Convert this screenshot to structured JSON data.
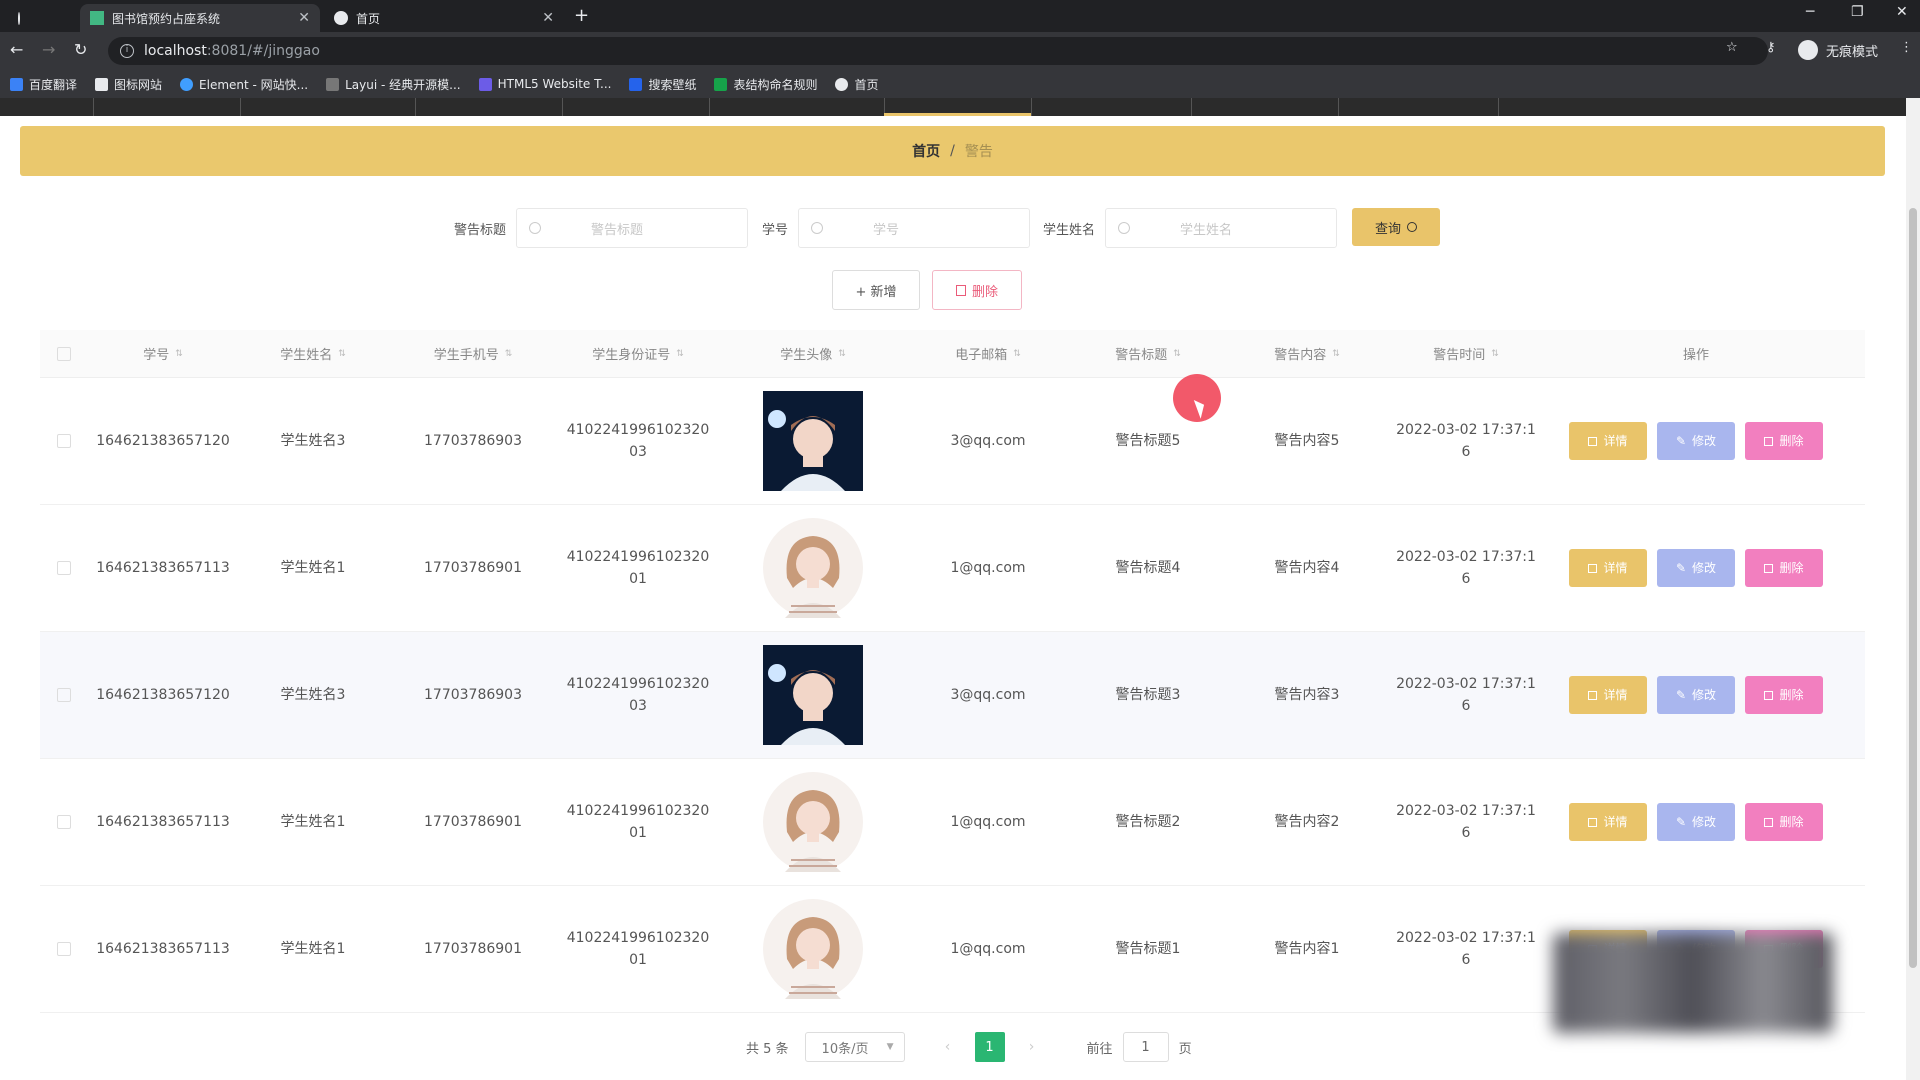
{
  "browser": {
    "tabs": [
      {
        "title": "图书馆预约占座系统"
      },
      {
        "title": "首页"
      }
    ],
    "url_host": "localhost",
    "url_path": ":8081/#/jinggao",
    "incognito_label": "无痕模式",
    "bookmarks": [
      "百度翻译",
      "图标网站",
      "Element - 网站快...",
      "Layui - 经典开源模...",
      "HTML5 Website T...",
      "搜索壁纸",
      "表结构命名规则",
      "首页"
    ]
  },
  "breadcrumb": {
    "home": "首页",
    "separator": "/",
    "current": "警告"
  },
  "search": {
    "title_label": "警告标题",
    "title_placeholder": "警告标题",
    "id_label": "学号",
    "id_placeholder": "学号",
    "name_label": "学生姓名",
    "name_placeholder": "学生姓名",
    "query_label": "查询"
  },
  "actions": {
    "add_label": "+ 新增",
    "delete_label": "删除"
  },
  "table": {
    "headers": [
      "学号",
      "学生姓名",
      "学生手机号",
      "学生身份证号",
      "学生头像",
      "电子邮箱",
      "警告标题",
      "警告内容",
      "警告时间",
      "操作"
    ],
    "rows": [
      {
        "id": "164621383657120",
        "name": "学生姓名3",
        "phone": "17703786903",
        "idcard1": "4102241996102320",
        "idcard2": "03",
        "avatar": "male-avatar",
        "email": "3@qq.com",
        "title": "警告标题5",
        "content": "警告内容5",
        "time1": "2022-03-02 17:37:1",
        "time2": "6"
      },
      {
        "id": "164621383657113",
        "name": "学生姓名1",
        "phone": "17703786901",
        "idcard1": "4102241996102320",
        "idcard2": "01",
        "avatar": "female-avatar",
        "email": "1@qq.com",
        "title": "警告标题4",
        "content": "警告内容4",
        "time1": "2022-03-02 17:37:1",
        "time2": "6"
      },
      {
        "id": "164621383657120",
        "name": "学生姓名3",
        "phone": "17703786903",
        "idcard1": "4102241996102320",
        "idcard2": "03",
        "avatar": "male-avatar",
        "email": "3@qq.com",
        "title": "警告标题3",
        "content": "警告内容3",
        "time1": "2022-03-02 17:37:1",
        "time2": "6"
      },
      {
        "id": "164621383657113",
        "name": "学生姓名1",
        "phone": "17703786901",
        "idcard1": "4102241996102320",
        "idcard2": "01",
        "avatar": "female-avatar",
        "email": "1@qq.com",
        "title": "警告标题2",
        "content": "警告内容2",
        "time1": "2022-03-02 17:37:1",
        "time2": "6"
      },
      {
        "id": "164621383657113",
        "name": "学生姓名1",
        "phone": "17703786901",
        "idcard1": "4102241996102320",
        "idcard2": "01",
        "avatar": "female-avatar",
        "email": "1@qq.com",
        "title": "警告标题1",
        "content": "警告内容1",
        "time1": "2022-03-02 17:37:1",
        "time2": "6"
      }
    ],
    "op_detail": "详情",
    "op_edit": "修改",
    "op_delete": "删除"
  },
  "pager": {
    "total": "共 5 条",
    "page_size": "10条/页",
    "current_page": "1",
    "goto_label": "前往",
    "goto_value": "1",
    "page_suffix": "页"
  },
  "colors": {
    "accent": "#e9c46a",
    "edit": "#a9b6ee",
    "delete": "#f27fbf",
    "pager_active": "#2ab672"
  }
}
